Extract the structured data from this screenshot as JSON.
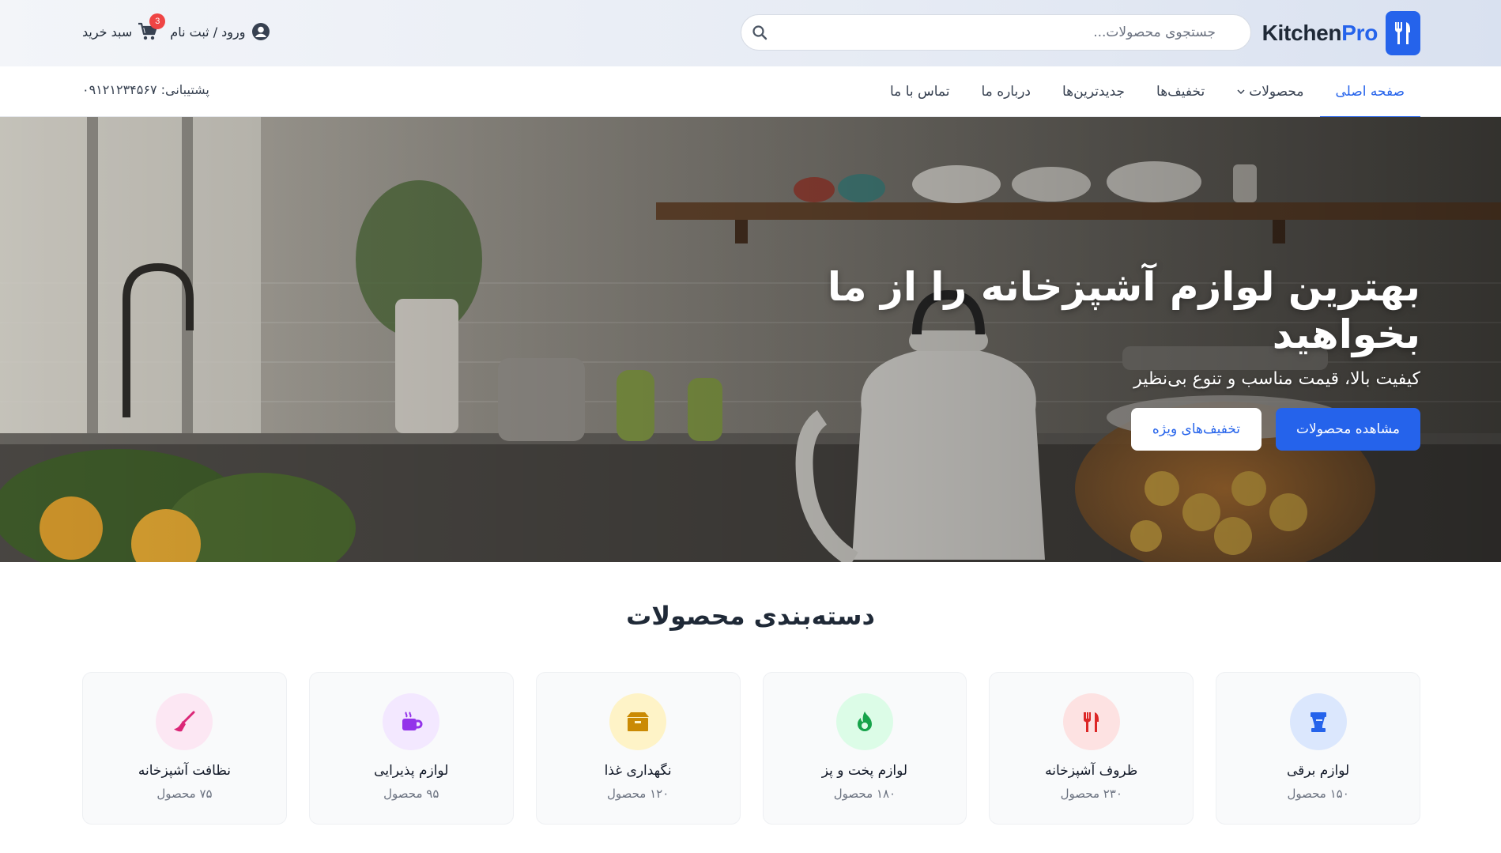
{
  "brand": {
    "name_part1": "Kitchen",
    "name_part2": "Pro",
    "accent_color": "#2563eb",
    "logo_icon": "fork-knife-icon"
  },
  "search": {
    "placeholder": "جستجوی محصولات...",
    "value": "",
    "icon": "search-icon"
  },
  "user": {
    "login_label": "ورود / ثبت نام",
    "cart_label": "سبد خرید",
    "cart_count": "3"
  },
  "nav": {
    "items": [
      {
        "label": "صفحه اصلی",
        "active": true
      },
      {
        "label": "محصولات",
        "has_dropdown": true
      },
      {
        "label": "تخفیف‌ها"
      },
      {
        "label": "جدیدترین‌ها"
      },
      {
        "label": "درباره ما"
      },
      {
        "label": "تماس با ما"
      }
    ],
    "support": "پشتیبانی: ۰۹۱۲۱۲۳۴۵۶۷"
  },
  "hero": {
    "title": "بهترین لوازم آشپزخانه را از ما بخواهید",
    "subtitle": "کیفیت بالا، قیمت مناسب و تنوع بی‌نظیر",
    "primary_button": "مشاهده محصولات",
    "secondary_button": "تخفیف‌های ویژه"
  },
  "categories": {
    "title": "دسته‌بندی محصولات",
    "items": [
      {
        "name": "لوازم برقی",
        "count": "۱۵۰ محصول",
        "icon": "blender-icon",
        "color": "#2563eb",
        "bg": "#dbe7fd"
      },
      {
        "name": "ظروف آشپزخانه",
        "count": "۲۳۰ محصول",
        "icon": "utensils-icon",
        "color": "#dc2626",
        "bg": "#fde2e2"
      },
      {
        "name": "لوازم پخت و پز",
        "count": "۱۸۰ محصول",
        "icon": "fire-icon",
        "color": "#16a34a",
        "bg": "#dcfce7"
      },
      {
        "name": "نگهداری غذا",
        "count": "۱۲۰ محصول",
        "icon": "box-icon",
        "color": "#ca8a04",
        "bg": "#fef3c7"
      },
      {
        "name": "لوازم پذیرایی",
        "count": "۹۵ محصول",
        "icon": "mug-hot-icon",
        "color": "#9333ea",
        "bg": "#f3e8ff"
      },
      {
        "name": "نظافت آشپزخانه",
        "count": "۷۵ محصول",
        "icon": "broom-icon",
        "color": "#db2777",
        "bg": "#fce7f3"
      }
    ]
  }
}
